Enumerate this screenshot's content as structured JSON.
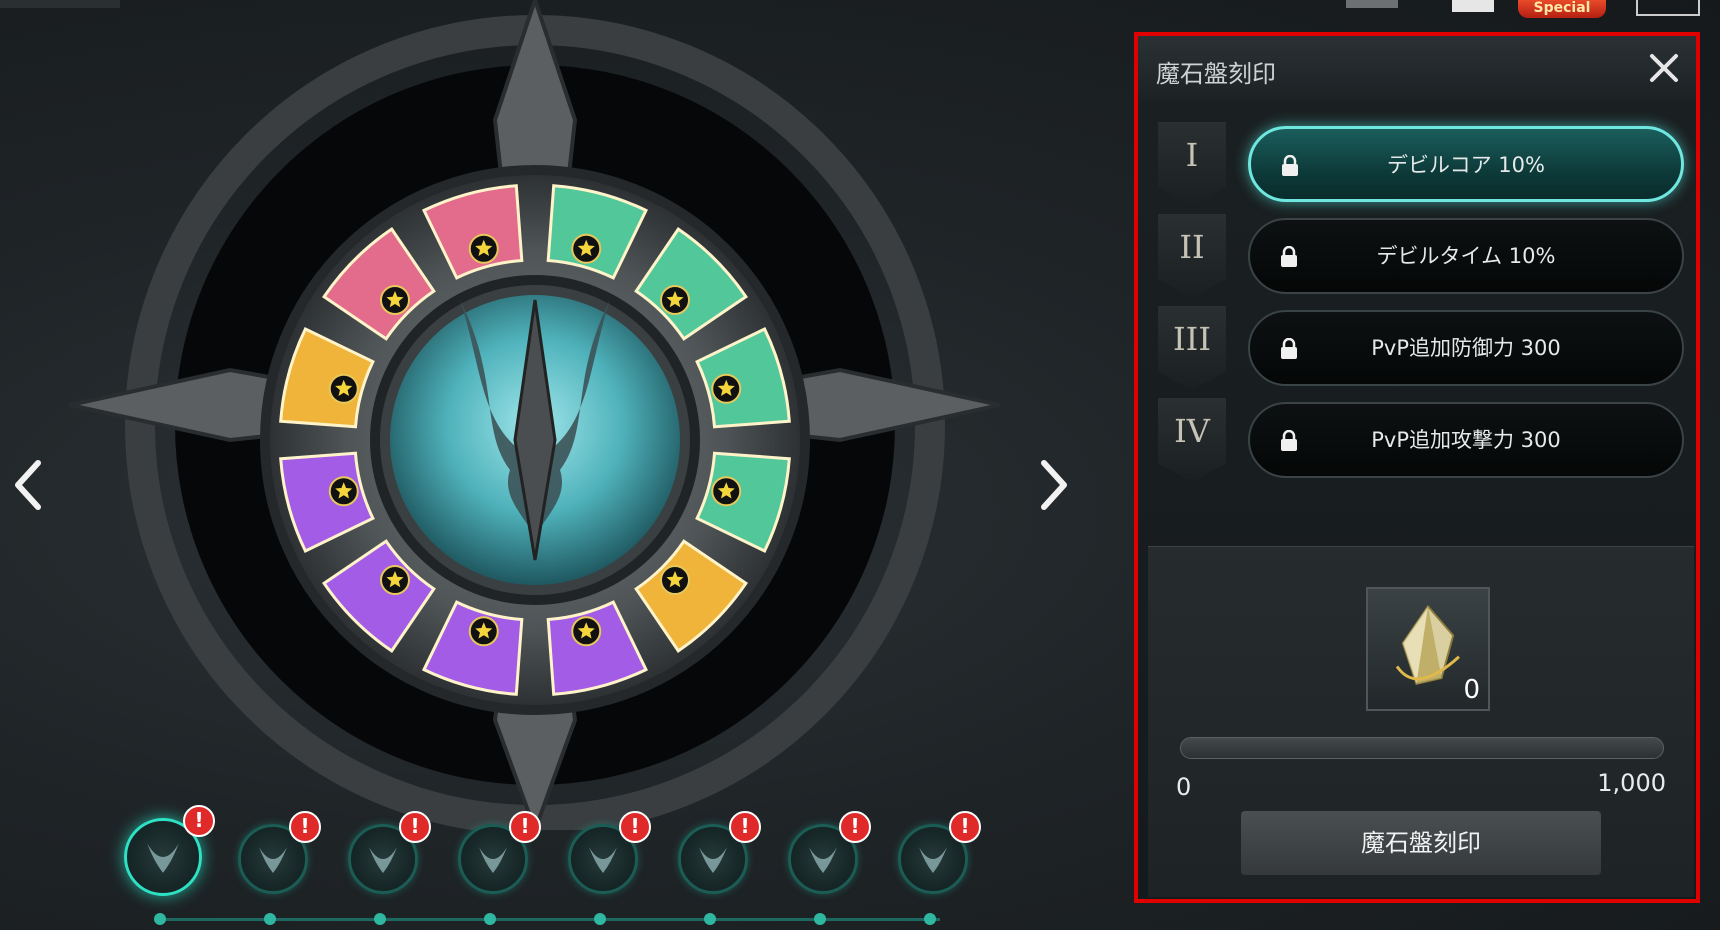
{
  "top_bar": {
    "special_label": "Special"
  },
  "wheel": {
    "slots": [
      {
        "color": "#52c79a"
      },
      {
        "color": "#52c79a"
      },
      {
        "color": "#52c79a"
      },
      {
        "color": "#52c79a"
      },
      {
        "color": "#f0b43a"
      },
      {
        "color": "#a35ce6"
      },
      {
        "color": "#a35ce6"
      },
      {
        "color": "#a35ce6"
      },
      {
        "color": "#a35ce6"
      },
      {
        "color": "#f0b43a"
      },
      {
        "color": "#e36c8c"
      },
      {
        "color": "#e36c8c"
      }
    ],
    "center_color": "#5fc0c8"
  },
  "navigation": {
    "prev_icon": "chevron-left-icon",
    "next_icon": "chevron-right-icon"
  },
  "spirits": [
    {
      "active": true,
      "alert": "!"
    },
    {
      "active": false,
      "alert": "!"
    },
    {
      "active": false,
      "alert": "!"
    },
    {
      "active": false,
      "alert": "!"
    },
    {
      "active": false,
      "alert": "!"
    },
    {
      "active": false,
      "alert": "!"
    },
    {
      "active": false,
      "alert": "!"
    },
    {
      "active": false,
      "alert": "!"
    }
  ],
  "panel": {
    "title": "魔石盤刻印",
    "close_icon": "close-icon",
    "engravings": [
      {
        "numeral": "I",
        "label": "デビルコア 10%",
        "locked": true,
        "active": true
      },
      {
        "numeral": "II",
        "label": "デビルタイム 10%",
        "locked": true,
        "active": false
      },
      {
        "numeral": "III",
        "label": "PvP追加防御力 300",
        "locked": true,
        "active": false
      },
      {
        "numeral": "IV",
        "label": "PvP追加攻撃力 300",
        "locked": true,
        "active": false
      }
    ],
    "material": {
      "icon": "crystal-icon",
      "count": "0"
    },
    "slider": {
      "min_label": "0",
      "max_label": "1,000",
      "value": 0
    },
    "engrave_button": "魔石盤刻印"
  },
  "colors": {
    "accent": "#3dc7b2",
    "highlight_border": "#e00000",
    "alert": "#e02a2a"
  }
}
